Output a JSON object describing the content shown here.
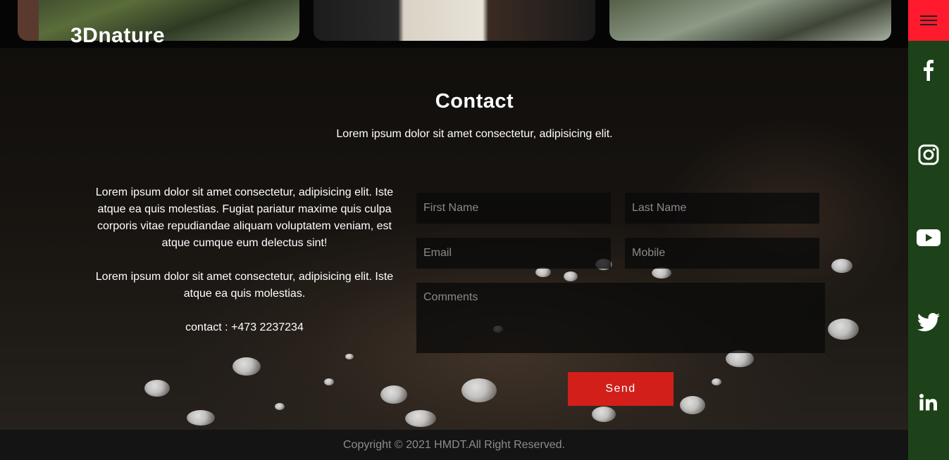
{
  "brand": {
    "name": "3Dnature"
  },
  "contact": {
    "title": "Contact",
    "subtitle": "Lorem ipsum dolor sit amet consectetur, adipisicing elit.",
    "info": {
      "paragraph1": "Lorem ipsum dolor sit amet consectetur, adipisicing elit. Iste atque ea quis molestias. Fugiat pariatur maxime quis culpa corporis vitae repudiandae aliquam voluptatem veniam, est atque cumque eum delectus sint!",
      "paragraph2": "Lorem ipsum dolor sit amet consectetur, adipisicing elit. Iste atque ea quis molestias.",
      "phone": "contact : +473 2237234"
    },
    "form": {
      "first_name_placeholder": "First Name",
      "last_name_placeholder": "Last Name",
      "email_placeholder": "Email",
      "mobile_placeholder": "Mobile",
      "comments_placeholder": "Comments",
      "send_label": "Send"
    }
  },
  "footer": {
    "copyright": "Copyright © 2021 HMDT.All Right Reserved."
  },
  "sidebar": {
    "menu_icon": "hamburger-icon",
    "social": [
      {
        "name": "facebook-icon"
      },
      {
        "name": "instagram-icon"
      },
      {
        "name": "youtube-icon"
      },
      {
        "name": "twitter-icon"
      },
      {
        "name": "linkedin-icon"
      }
    ]
  },
  "colors": {
    "accent_red": "#d21f1a",
    "menu_red": "#ff1a2e",
    "sidebar_green": "#1d4219",
    "footer_bg": "#141414"
  }
}
